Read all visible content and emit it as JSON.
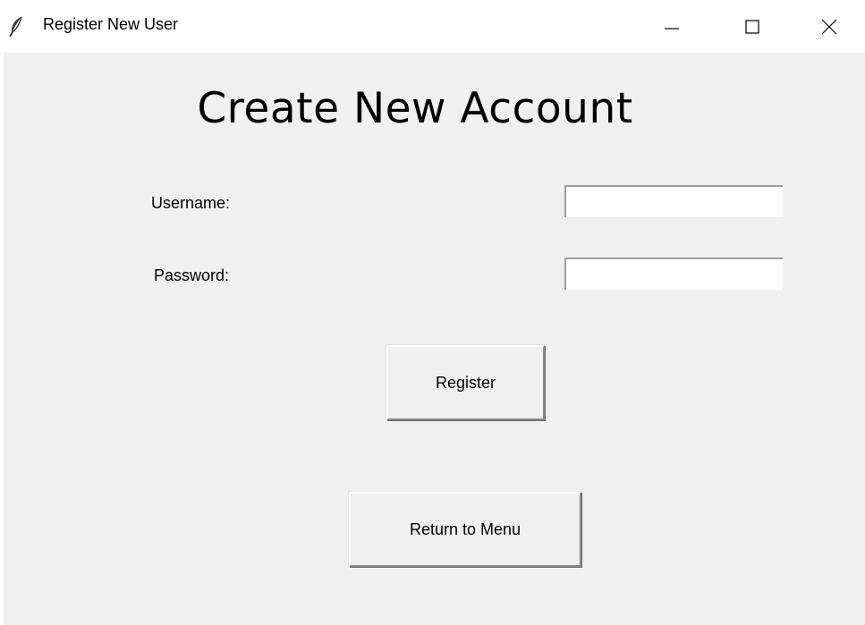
{
  "window": {
    "title": "Register New User",
    "icon": "feather-icon",
    "controls": [
      "minimize-icon",
      "maximize-icon",
      "close-icon"
    ]
  },
  "form": {
    "heading": "Create New Account",
    "username_label": "Username:",
    "username_value": "",
    "password_label": "Password:",
    "password_value": "",
    "register_label": "Register",
    "return_label": "Return to Menu"
  },
  "colors": {
    "background": "#f0f0f0",
    "titlebar": "#ffffff",
    "entry_background": "#ffffff"
  }
}
